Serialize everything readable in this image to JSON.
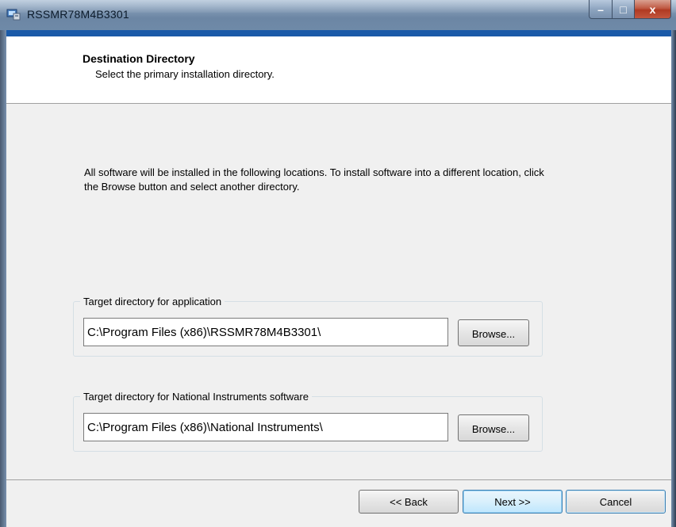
{
  "window": {
    "title": "RSSMR78M4B3301",
    "minimize_label": "–",
    "maximize_label": "□",
    "close_label": "x"
  },
  "header": {
    "title": "Destination Directory",
    "subtitle": "Select the primary installation directory."
  },
  "content": {
    "description": "All software will be installed in the following locations. To install software into a different location, click the Browse button and select another directory."
  },
  "groups": [
    {
      "label": "Target directory for application",
      "path": "C:\\Program Files (x86)\\RSSMR78M4B3301\\",
      "browse_label": "Browse..."
    },
    {
      "label": "Target directory for National Instruments software",
      "path": "C:\\Program Files (x86)\\National Instruments\\",
      "browse_label": "Browse..."
    }
  ],
  "footer": {
    "back_label": "<< Back",
    "next_label": "Next >>",
    "cancel_label": "Cancel"
  },
  "colors": {
    "accent_strip": "#1a5aa8",
    "background": "#f0f0f0"
  }
}
